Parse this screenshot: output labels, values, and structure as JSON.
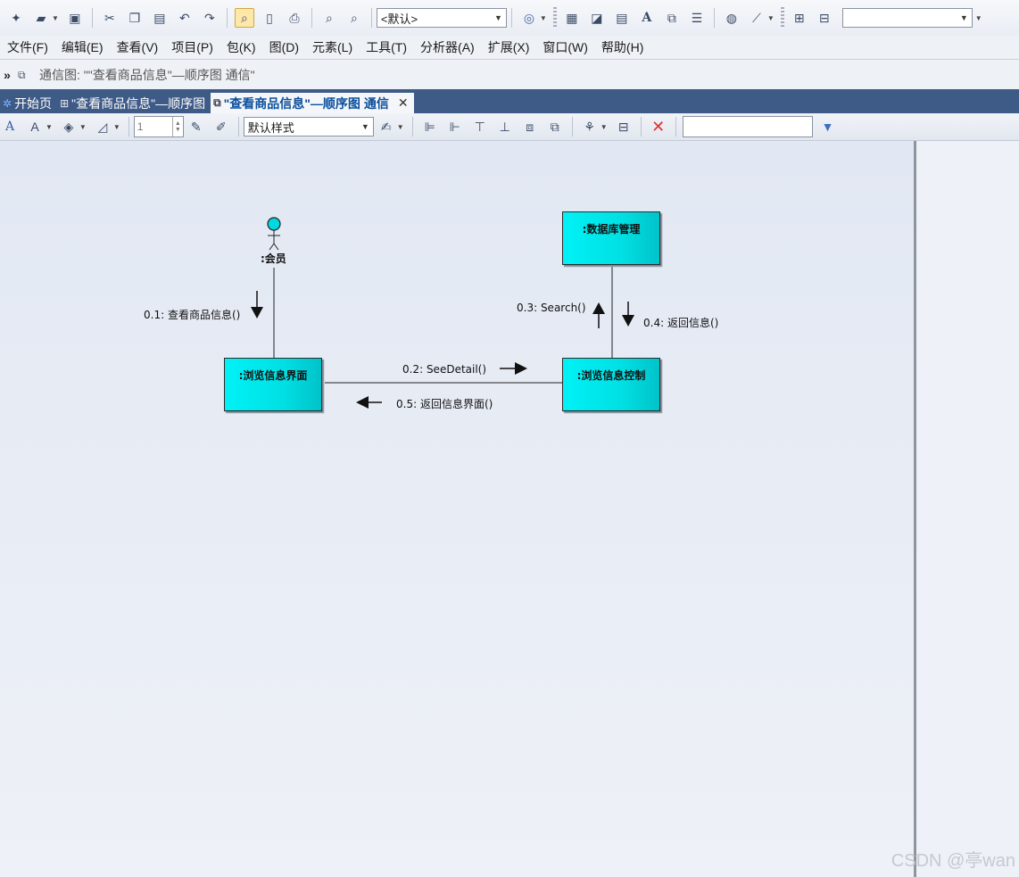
{
  "toolbar1": {
    "perspective_select": "<默认>",
    "right_select": ""
  },
  "menu": [
    "文件(F)",
    "编辑(E)",
    "查看(V)",
    "项目(P)",
    "包(K)",
    "图(D)",
    "元素(L)",
    "工具(T)",
    "分析器(A)",
    "扩展(X)",
    "窗口(W)",
    "帮助(H)"
  ],
  "breadcrumb": {
    "chevron": "»",
    "text": "通信图: \"\"查看商品信息\"—顺序图 通信\""
  },
  "tabs": [
    {
      "label": "开始页",
      "icon": "start-page-icon"
    },
    {
      "label": "\"查看商品信息\"—顺序图",
      "icon": "sequence-diagram-icon"
    },
    {
      "label": "\"查看商品信息\"—顺序图 通信",
      "icon": "communication-diagram-icon",
      "active": true,
      "close": "✕"
    }
  ],
  "toolbar2": {
    "line_width": "1",
    "style_select": "默认样式",
    "search_value": ""
  },
  "diagram": {
    "actor": {
      "label": ":会员"
    },
    "nodes": {
      "db": ":数据库管理",
      "ui": ":浏览信息界面",
      "ctrl": ":浏览信息控制"
    },
    "messages": {
      "m1": "0.1: 查看商品信息()",
      "m2": "0.2: SeeDetail()",
      "m3": "0.3: Search()",
      "m4": "0.4: 返回信息()",
      "m5": "0.5: 返回信息界面()"
    }
  },
  "watermark": "CSDN @亭wan"
}
